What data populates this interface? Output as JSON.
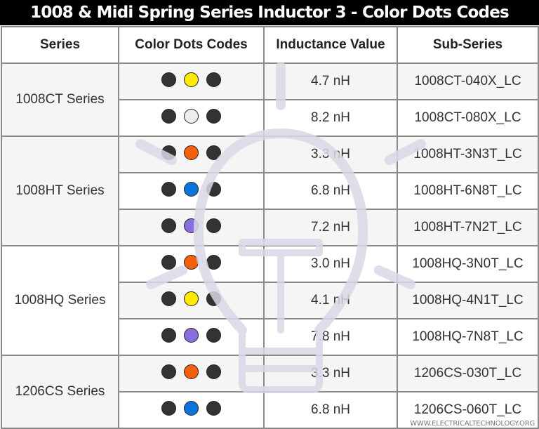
{
  "title": "1008 & Midi Spring Series Inductor 3 - Color Dots Codes",
  "table": {
    "headers": [
      "Series",
      "Color Dots Codes",
      "Inductance Value",
      "Sub-Series"
    ],
    "groups": [
      {
        "series": "1008CT Series",
        "rows": [
          {
            "dots": [
              "#333333",
              "#ffeb00",
              "#333333"
            ],
            "inductance": "4.7 nH",
            "sub_series": "1008CT-040X_LC"
          },
          {
            "dots": [
              "#333333",
              "#eeeeee",
              "#333333"
            ],
            "inductance": "8.2 nH",
            "sub_series": "1008CT-080X_LC"
          }
        ]
      },
      {
        "series": "1008HT Series",
        "rows": [
          {
            "dots": [
              "#333333",
              "#f4600c",
              "#333333"
            ],
            "inductance": "3.3 nH",
            "sub_series": "1008HT-3N3T_LC"
          },
          {
            "dots": [
              "#333333",
              "#0a74da",
              "#333333"
            ],
            "inductance": "6.8 nH",
            "sub_series": "1008HT-6N8T_LC"
          },
          {
            "dots": [
              "#333333",
              "#8a6ee0",
              "#333333"
            ],
            "inductance": "7.2 nH",
            "sub_series": "1008HT-7N2T_LC"
          }
        ]
      },
      {
        "series": "1008HQ Series",
        "rows": [
          {
            "dots": [
              "#333333",
              "#f4600c",
              "#333333"
            ],
            "inductance": "3.0 nH",
            "sub_series": "1008HQ-3N0T_LC"
          },
          {
            "dots": [
              "#333333",
              "#ffeb00",
              "#333333"
            ],
            "inductance": "4.1 nH",
            "sub_series": "1008HQ-4N1T_LC"
          },
          {
            "dots": [
              "#333333",
              "#8a6ee0",
              "#333333"
            ],
            "inductance": "7.8 nH",
            "sub_series": "1008HQ-7N8T_LC"
          }
        ]
      },
      {
        "series": "1206CS Series",
        "rows": [
          {
            "dots": [
              "#333333",
              "#f4600c",
              "#333333"
            ],
            "inductance": "3.3 nH",
            "sub_series": "1206CS-030T_LC"
          },
          {
            "dots": [
              "#333333",
              "#0a74da",
              "#333333"
            ],
            "inductance": "6.8 nH",
            "sub_series": "1206CS-060T_LC"
          }
        ]
      }
    ]
  },
  "watermark": {
    "icon": "lightbulb-icon"
  },
  "credit": "WWW.ELECTRICALTECHNOLOGY.ORG",
  "colors": {
    "title_bg": "#000000",
    "title_text": "#ffffff",
    "border": "#8a8a8a",
    "alt_row": "#f5f5f5",
    "watermark": "#d9d9e8"
  }
}
